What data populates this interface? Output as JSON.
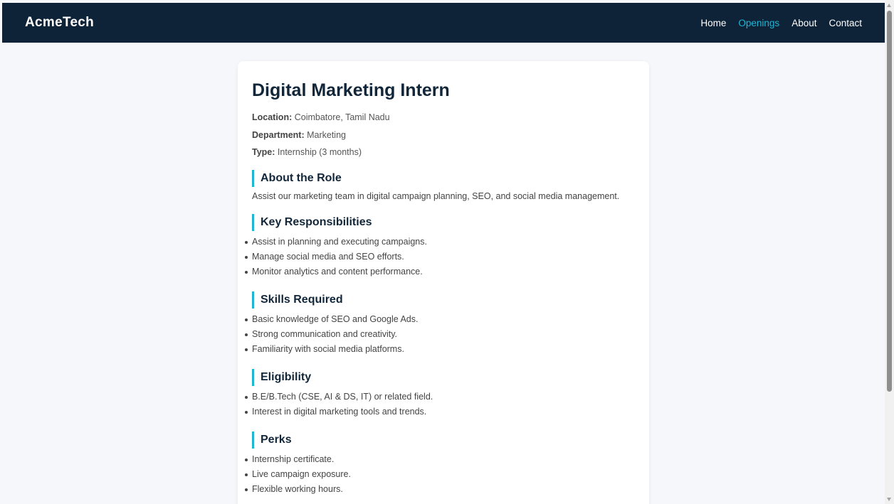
{
  "nav": {
    "brand": "AcmeTech",
    "links": [
      {
        "label": "Home",
        "active": false
      },
      {
        "label": "Openings",
        "active": true
      },
      {
        "label": "About",
        "active": false
      },
      {
        "label": "Contact",
        "active": false
      }
    ],
    "background_color": "#0e2238",
    "accent_color": "#1fb6d4"
  },
  "job": {
    "title": "Digital Marketing Intern",
    "meta": [
      {
        "label": "Location:",
        "value": "Coimbatore, Tamil Nadu"
      },
      {
        "label": "Department:",
        "value": "Marketing"
      },
      {
        "label": "Type:",
        "value": "Internship (3 months)"
      }
    ],
    "about": {
      "heading": "About the Role",
      "text": "Assist our marketing team in digital campaign planning, SEO, and social media management."
    },
    "responsibilities": {
      "heading": "Key Responsibilities",
      "items": [
        "Assist in planning and executing campaigns.",
        "Manage social media and SEO efforts.",
        "Monitor analytics and content performance."
      ]
    },
    "skills": {
      "heading": "Skills Required",
      "items": [
        "Basic knowledge of SEO and Google Ads.",
        "Strong communication and creativity.",
        "Familiarity with social media platforms."
      ]
    },
    "eligibility": {
      "heading": "Eligibility",
      "items": [
        "B.E/B.Tech (CSE, AI & DS, IT) or related field.",
        "Interest in digital marketing tools and trends."
      ]
    },
    "perks": {
      "heading": "Perks",
      "items": [
        "Internship certificate.",
        "Live campaign exposure.",
        "Flexible working hours."
      ]
    }
  }
}
